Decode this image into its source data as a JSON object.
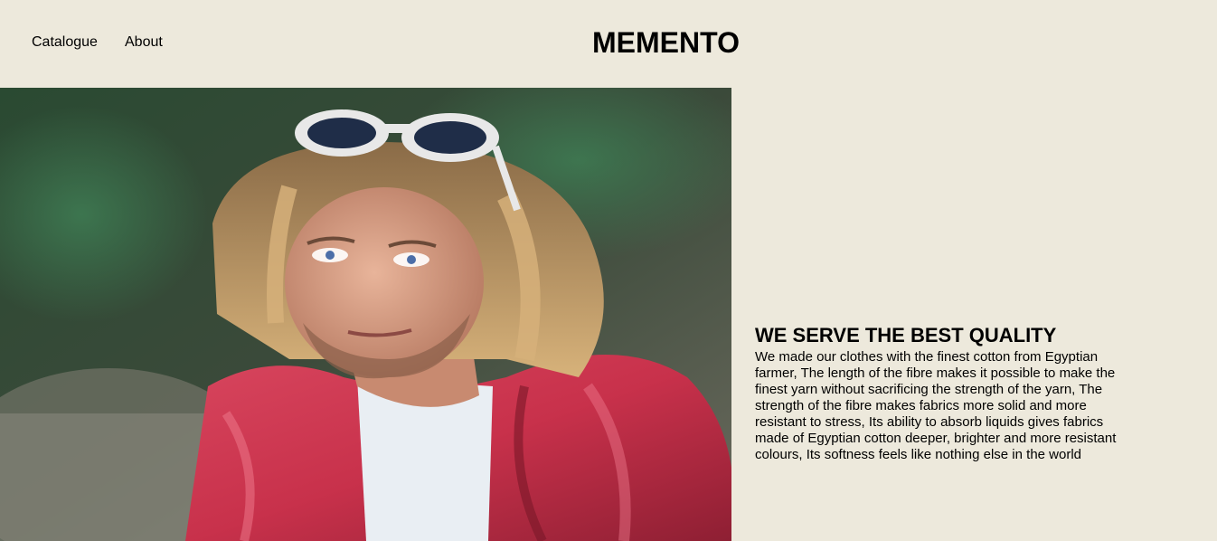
{
  "nav": {
    "catalogue_label": "Catalogue",
    "about_label": "About"
  },
  "brand": {
    "name": "MEMENTO"
  },
  "hero": {
    "image_alt": "photo",
    "background_color": "#ede9dc",
    "jacket_color": "#c8314b"
  },
  "info": {
    "title": "WE SERVE THE BEST QUALITY",
    "body": "We made our clothes with the finest cotton from Egyptian farmer, The length of the fibre makes it possible to make the finest yarn without sacrificing the strength of the yarn, The strength of the fibre makes fabrics more solid and more resistant to stress, Its ability to absorb liquids gives fabrics made of Egyptian cotton deeper, brighter and more resistant colours, Its softness feels like nothing else in the world"
  }
}
